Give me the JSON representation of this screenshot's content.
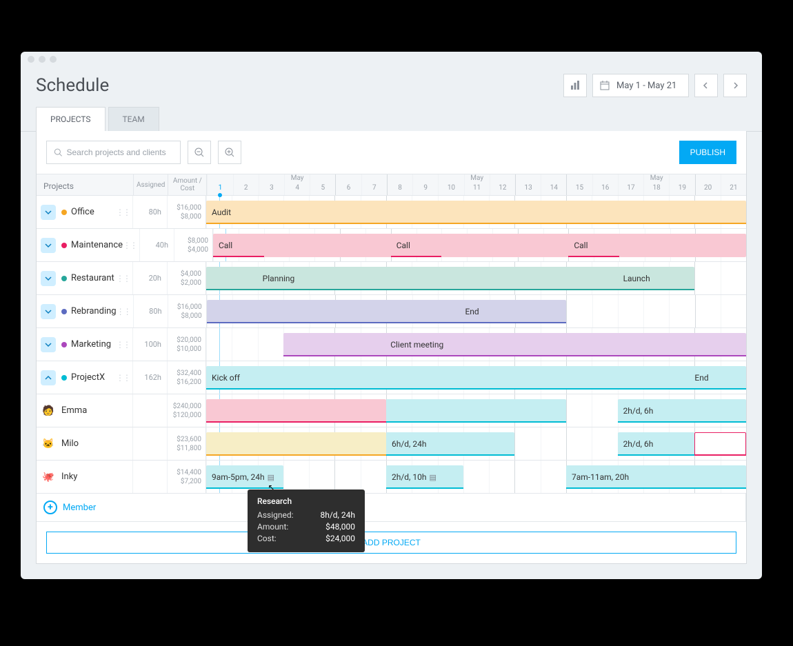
{
  "page_title": "Schedule",
  "date_range": "May 1 - May 21",
  "tabs": {
    "projects": "PROJECTS",
    "team": "TEAM",
    "active": "projects"
  },
  "search_placeholder": "Search projects and clients",
  "publish_label": "PUBLISH",
  "columns": {
    "projects": "Projects",
    "assigned": "Assigned",
    "amount": "Amount / Cost"
  },
  "month_label": "May",
  "days": [
    1,
    2,
    3,
    4,
    5,
    6,
    7,
    8,
    9,
    10,
    11,
    12,
    13,
    14,
    15,
    16,
    17,
    18,
    19,
    20,
    21
  ],
  "weekend_starts": [
    6,
    8,
    13,
    15,
    20
  ],
  "projects": [
    {
      "name": "Office",
      "dot": "#f5a623",
      "assigned": "80h",
      "amount": "$16,000",
      "cost": "$8,000",
      "bars": [
        {
          "label": "Audit",
          "cls": "c-orange",
          "start": 1,
          "end": 21,
          "segments": "full"
        }
      ]
    },
    {
      "name": "Maintenance",
      "dot": "#e91e63",
      "assigned": "40h",
      "amount": "$8,000",
      "cost": "$4,000",
      "bars": [
        {
          "label": "Call",
          "cls": "c-pink",
          "start": 1,
          "end": 21,
          "tags": [
            {
              "day": 1,
              "text": "Call"
            },
            {
              "day": 8,
              "text": "Call"
            },
            {
              "day": 15,
              "text": "Call"
            }
          ]
        }
      ]
    },
    {
      "name": "Restaurant",
      "dot": "#26a69a",
      "assigned": "20h",
      "amount": "$4,000",
      "cost": "$2,000",
      "bars": [
        {
          "label": "Planning",
          "cls": "c-teal",
          "start": 1,
          "end": 18,
          "labelDay": 3
        },
        {
          "label": "Launch",
          "cls": "c-teal",
          "start": 17,
          "end": 19,
          "labelDay": 17
        }
      ]
    },
    {
      "name": "Rebranding",
      "dot": "#5c6bc0",
      "assigned": "80h",
      "amount": "$16,000",
      "cost": "$8,000",
      "bars": [
        {
          "label": "End",
          "cls": "c-indigo",
          "start": 1,
          "end": 14,
          "labelDay": 11
        }
      ]
    },
    {
      "name": "Marketing",
      "dot": "#ab47bc",
      "assigned": "100h",
      "amount": "$20,000",
      "cost": "$10,000",
      "bars": [
        {
          "label": "Client meeting",
          "cls": "c-purple",
          "start": 4,
          "end": 21,
          "labelDay": 8
        }
      ]
    },
    {
      "name": "ProjectX",
      "dot": "#00bcd4",
      "assigned": "162h",
      "amount": "$32,400",
      "cost": "$16,200",
      "expanded": true,
      "bars": [
        {
          "label": "Kick off",
          "cls": "c-cyan",
          "start": 1,
          "end": 21,
          "labelDay": 1,
          "extra": [
            {
              "day": 20,
              "text": "End"
            }
          ]
        }
      ]
    }
  ],
  "members": [
    {
      "name": "Emma",
      "avatar": "🧑",
      "amount": "$240,000",
      "cost": "$120,000",
      "bars": [
        {
          "cls": "c-pink",
          "start": 1,
          "end": 7,
          "ul": "#e91e63"
        },
        {
          "cls": "c-cyan",
          "start": 8,
          "end": 14,
          "ul": "#00bcd4"
        },
        {
          "cls": "c-cyan",
          "start": 17,
          "end": 21,
          "text": "2h/d, 6h",
          "ul": "#00bcd4"
        }
      ]
    },
    {
      "name": "Milo",
      "avatar": "🐱",
      "amount": "$23,600",
      "cost": "$11,800",
      "bars": [
        {
          "cls": "c-yellow",
          "start": 1,
          "end": 7,
          "ul": "#f5a623"
        },
        {
          "cls": "c-cyan",
          "start": 8,
          "end": 12,
          "text": "6h/d, 24h",
          "ul": "#00bcd4"
        },
        {
          "cls": "c-cyan",
          "start": 17,
          "end": 19,
          "text": "2h/d, 6h",
          "ul": "#00bcd4"
        },
        {
          "cls": "",
          "start": 20,
          "end": 21,
          "ul": "#e91e63",
          "bg": "#fff",
          "border": "#e91e63"
        }
      ]
    },
    {
      "name": "Inky",
      "avatar": "🐙",
      "amount": "$14,400",
      "cost": "$7,200",
      "bars": [
        {
          "cls": "c-cyan",
          "start": 1,
          "end": 3,
          "text": "9am-5pm, 24h",
          "ul": "#00bcd4",
          "icon": true
        },
        {
          "cls": "c-cyan",
          "start": 8,
          "end": 10,
          "text": "2h/d, 10h",
          "ul": "#00bcd4",
          "icon": true
        },
        {
          "cls": "c-cyan",
          "start": 15,
          "end": 21,
          "text": "7am-11am, 20h",
          "ul": "#00bcd4"
        }
      ]
    }
  ],
  "add_member_label": "Member",
  "add_project_label": "ADD PROJECT",
  "tooltip": {
    "title": "Research",
    "rows": [
      {
        "label": "Assigned:",
        "value": "8h/d, 24h"
      },
      {
        "label": "Amount:",
        "value": "$48,000"
      },
      {
        "label": "Cost:",
        "value": "$24,000"
      }
    ]
  }
}
